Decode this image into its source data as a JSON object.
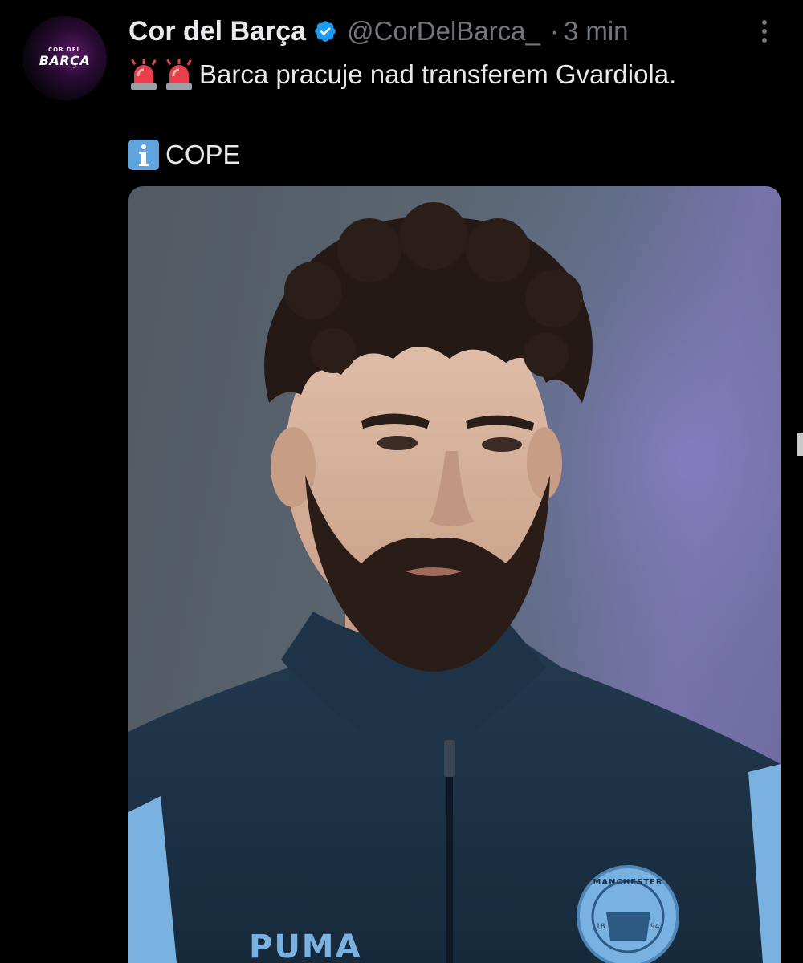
{
  "author": {
    "display_name": "Cor del Barça",
    "handle": "@CorDelBarca_",
    "separator": "·",
    "time": "3 min",
    "avatar_small": "COR DEL",
    "avatar_big": "BARÇA"
  },
  "tweet": {
    "line1_emojis": [
      "siren-icon",
      "siren-icon"
    ],
    "line1_text": "Barca pracuje nad transferem Gvardiola.",
    "line2_emoji": "info-icon",
    "line2_text": "COPE"
  },
  "media": {
    "brand_text": "PUMA",
    "crest_text": "MANCHESTER",
    "crest_year_left": "18",
    "crest_year_right": "94"
  },
  "colors": {
    "background": "#000000",
    "text_primary": "#e7e9ea",
    "text_secondary": "#71767b",
    "verified": "#1d9bf0",
    "jacket": "#1c3146",
    "sleeve": "#79b1e0"
  }
}
